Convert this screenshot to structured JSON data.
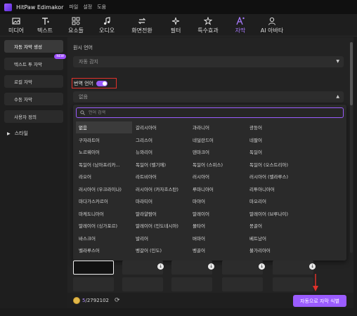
{
  "titlebar": {
    "app_name": "HitPaw Edimakor",
    "menus": [
      "파일",
      "설정",
      "도움"
    ]
  },
  "toolbar": [
    {
      "label": "미디어",
      "icon": "media-icon"
    },
    {
      "label": "텍스트",
      "icon": "text-icon"
    },
    {
      "label": "요소들",
      "icon": "elements-icon"
    },
    {
      "label": "오디오",
      "icon": "audio-icon"
    },
    {
      "label": "화면전환",
      "icon": "transition-icon"
    },
    {
      "label": "필터",
      "icon": "filter-icon"
    },
    {
      "label": "특수효과",
      "icon": "effects-icon"
    },
    {
      "label": "자막",
      "icon": "subtitle-icon"
    },
    {
      "label": "AI 아바타",
      "icon": "avatar-icon"
    }
  ],
  "sidebar": {
    "items": [
      "자동 자막 생성",
      "텍스트 투 자막",
      "로컬 자막",
      "수동 자막",
      "사용자 정의"
    ],
    "new_badge": "NEW",
    "style": "스타일"
  },
  "main": {
    "source_label": "원시 언어",
    "source_value": "자동 감지",
    "translate_label": "번역 언어",
    "translate_value": "없음",
    "search_placeholder": "언어 검색",
    "languages": [
      "없음",
      "갈리시아어",
      "과라니어",
      "광둥어",
      "구자라트어",
      "그리스어",
      "네덜란드어",
      "네팔어",
      "노르웨이어",
      "뉴와리어",
      "덴마크어",
      "독일어",
      "독일어 (남아프리카...",
      "독일어 (벨기에)",
      "독일어 (스위스)",
      "독일어 (오스트리아)",
      "라오어",
      "라트비아어",
      "러시아어",
      "러시아어 (벨라루스)",
      "러시아어 (우크라이나)",
      "러시아어 (카자흐스탄)",
      "루마니아어",
      "리투아니아어",
      "마다가스카르어",
      "마라티어",
      "마야어",
      "마오리어",
      "마케도니아어",
      "말라얄람어",
      "말레이어",
      "말레이어 (브루나이)",
      "말레이어 (싱가포르)",
      "말레이어 (인도네시아)",
      "몰타어",
      "몽골어",
      "바스크어",
      "발리어",
      "버마어",
      "베트남어",
      "벨라루스어",
      "벵갈어 (인도)",
      "벵골어",
      "불가리아어"
    ]
  },
  "bottom": {
    "credits_used": "5",
    "credits_total": "/2792102",
    "cta": "자동으로 자막 식별"
  },
  "colors": {
    "accent": "#9b5cff",
    "highlight": "#e0312b"
  }
}
